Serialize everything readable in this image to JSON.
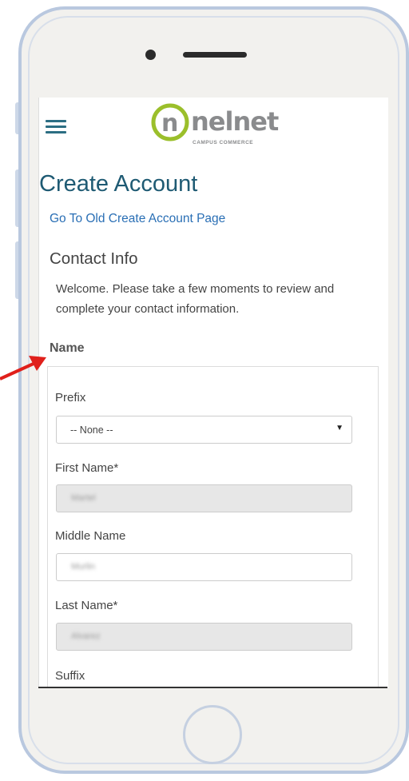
{
  "app": {
    "logo_text": "nelnet",
    "logo_subtext": "CAMPUS COMMERCE"
  },
  "page": {
    "title": "Create Account",
    "old_page_link": "Go To Old Create Account Page",
    "section_title": "Contact Info",
    "welcome_text": "Welcome. Please take a few moments to review and complete your contact information."
  },
  "name_section": {
    "heading": "Name",
    "prefix": {
      "label": "Prefix",
      "value": "-- None --"
    },
    "first_name": {
      "label": "First Name*",
      "value": "Martel"
    },
    "middle_name": {
      "label": "Middle Name",
      "value": "Murlin"
    },
    "last_name": {
      "label": "Last Name*",
      "value": "Alvarez"
    },
    "suffix": {
      "label": "Suffix"
    }
  },
  "colors": {
    "brand_teal": "#1e5a73",
    "logo_green": "#9bbf2b",
    "link_blue": "#2a6fb5",
    "annotation_arrow": "#e0201b",
    "phone_frame": "#b9c8df"
  },
  "icons": {
    "menu": "hamburger-icon",
    "dropdown": "caret-down-icon",
    "annotation": "red-arrow-pointer"
  }
}
